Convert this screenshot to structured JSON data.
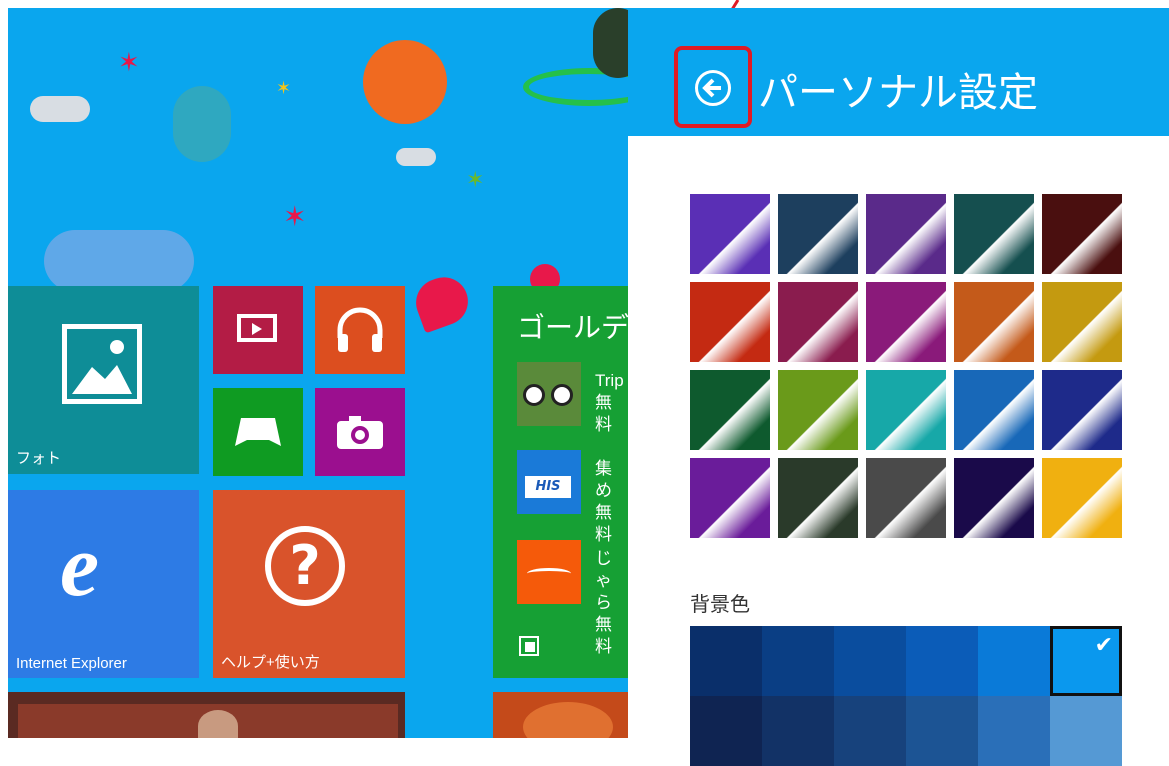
{
  "start_screen": {
    "tiles": {
      "photos": {
        "label": "フォト",
        "color": "#0e8d97"
      },
      "video": {
        "color": "#b31c45"
      },
      "music": {
        "color": "#dc4e1f"
      },
      "games": {
        "color": "#0f9b22"
      },
      "camera": {
        "color": "#9b0f8f"
      },
      "ie": {
        "label": "Internet Explorer",
        "color": "#2d7be5"
      },
      "help": {
        "label": "ヘルプ+使い方",
        "color": "#d9532b"
      },
      "store": {
        "title": "ゴールデ",
        "color": "#16a034",
        "items": [
          {
            "line1": "Trip",
            "line2": "無料"
          },
          {
            "line1": "集め",
            "line2": "無料"
          },
          {
            "line1": "じゃら",
            "line2": "無料"
          }
        ]
      }
    }
  },
  "settings_panel": {
    "title": "パーソナル設定",
    "background_label": "背景色",
    "header_color": "#0aa6ee",
    "pattern_swatches": [
      "#5a2fb5",
      "#1d3f5e",
      "#5a2a8a",
      "#154f4f",
      "#4a0f0f",
      "#c42a12",
      "#8a1c4e",
      "#8a1a7a",
      "#c45a1a",
      "#c49a10",
      "#0e5a2e",
      "#6a9a1a",
      "#17a8a8",
      "#1868b8",
      "#1e2a8a",
      "#6a1c9a",
      "#2a3a2a",
      "#4a4a4a",
      "#1a0a4a",
      "#f0b010"
    ],
    "background_colors": [
      [
        "#0a2f6a",
        "#0a3e84",
        "#0a4d9e",
        "#0b5cb8",
        "#0a7ad8",
        "#0a98ee"
      ],
      [
        "#0f2452",
        "#123266",
        "#17427c",
        "#1c5494",
        "#2a6fb8",
        "#5599d4"
      ]
    ],
    "selected_color_index": 5
  }
}
